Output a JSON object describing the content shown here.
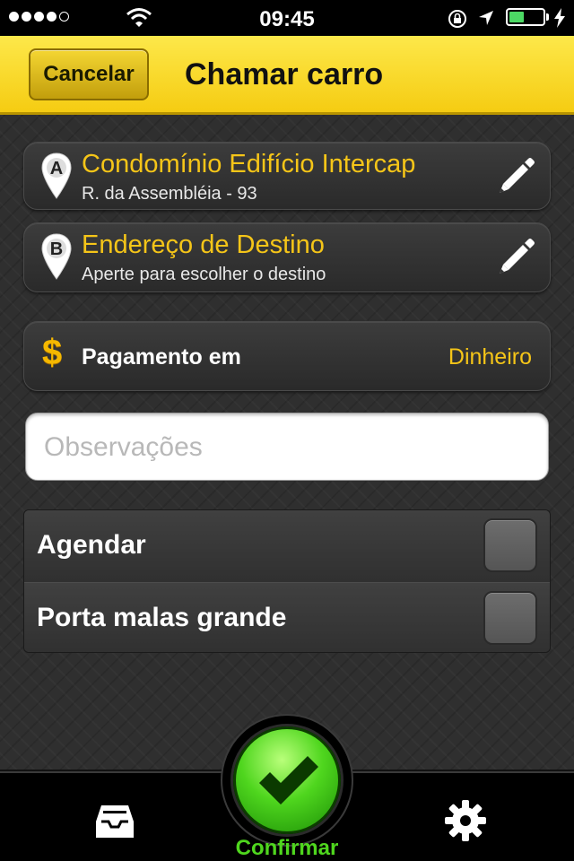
{
  "status_bar": {
    "time": "09:45",
    "signal_dots": 5,
    "signal_filled": 4,
    "battery_level": 0.45,
    "battery_color": "#4cd964",
    "icons": [
      "wifi-icon",
      "rotation-lock-icon",
      "location-arrow-icon",
      "battery-icon",
      "charging-bolt-icon"
    ]
  },
  "nav": {
    "cancel_label": "Cancelar",
    "title": "Chamar carro",
    "bar_color": "#f8d61c"
  },
  "pickup": {
    "pin_letter": "A",
    "title": "Condomínio Edifício Intercap",
    "subtitle": "R. da Assembléia - 93",
    "edit_icon": "pencil-icon"
  },
  "destination": {
    "pin_letter": "B",
    "title": "Endereço de Destino",
    "subtitle": "Aperte para escolher o destino",
    "edit_icon": "pencil-icon"
  },
  "payment": {
    "icon_symbol": "$",
    "label": "Pagamento em",
    "value": "Dinheiro"
  },
  "observations": {
    "placeholder": "Observações",
    "value": ""
  },
  "options": [
    {
      "label": "Agendar",
      "checked": false
    },
    {
      "label": "Porta malas grande",
      "checked": false
    }
  ],
  "tab_bar": {
    "confirm_label": "Confirmar",
    "accent_color": "#4fd61e",
    "left_icon": "inbox-tray-icon",
    "right_icon": "gear-icon"
  }
}
